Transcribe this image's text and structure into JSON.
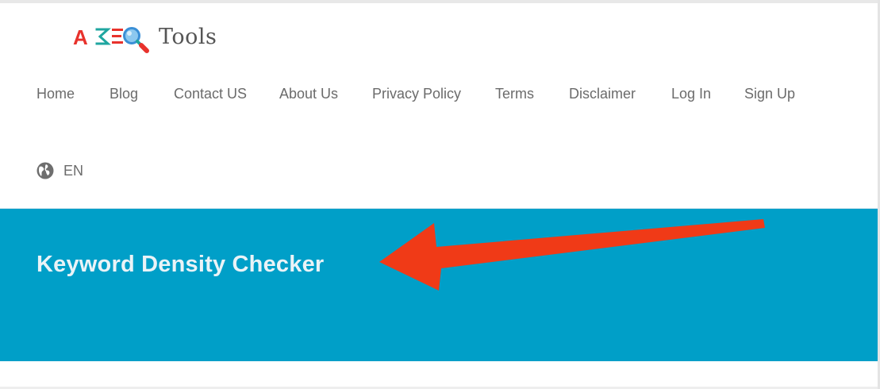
{
  "header": {
    "logo": {
      "letters": [
        "A",
        "S",
        "E",
        "O"
      ],
      "text": "Tools",
      "colors": {
        "red": "#e8322c",
        "teal": "#1fa6a0",
        "blue": "#3a8fd6"
      }
    },
    "nav": [
      {
        "label": "Home"
      },
      {
        "label": "Blog"
      },
      {
        "label": "Contact US"
      },
      {
        "label": "About Us"
      },
      {
        "label": "Privacy Policy"
      },
      {
        "label": "Terms"
      },
      {
        "label": "Disclaimer"
      },
      {
        "label": "Log In"
      },
      {
        "label": "Sign Up"
      }
    ],
    "language": {
      "icon": "globe-icon",
      "label": "EN"
    }
  },
  "hero": {
    "title": "Keyword Density Checker",
    "background": "#009fc8",
    "annotation_arrow_color": "#f03a17"
  }
}
